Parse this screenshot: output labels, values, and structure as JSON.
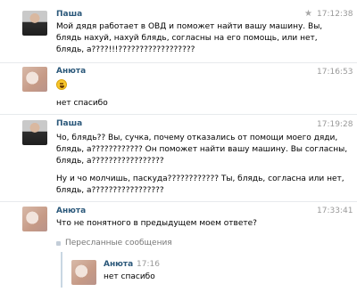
{
  "messages": [
    {
      "author": "Паша",
      "time": "17:12:38",
      "lines": [
        "Мой дядя работает в ОВД и поможет найти вашу машину. Вы,",
        "блядь нахуй, нахуй блядь, согласны на его помощь, или нет,",
        "блядь, а????!!!??????????????????"
      ]
    },
    {
      "author": "Анюта",
      "time": "17:16:53",
      "emoji": "laughing-face-icon",
      "lines": [
        "нет спасибо"
      ]
    },
    {
      "author": "Паша",
      "time": "17:19:28",
      "lines": [
        "Чо, блядь?? Вы, сучка, почему отказались от помощи моего дяди,",
        "блядь, а???????????? Он поможет найти вашу машину. Вы согласны,",
        "блядь, а?????????????????"
      ],
      "lines2": [
        "Ну и чо молчишь, паскуда???????????? Ты, блядь, согласна или нет,",
        "блядь, а?????????????????"
      ]
    },
    {
      "author": "Анюта",
      "time": "17:33:41",
      "lines": [
        "Что не понятного в предыдущем моем ответе?"
      ],
      "forwarded": {
        "label": "Пересланные сообщения",
        "author": "Анюта",
        "time": "17:16",
        "text": "нет спасибо"
      }
    }
  ],
  "colors": {
    "author": "#2b587a",
    "time": "#999999",
    "divider": "#e7eaed"
  }
}
